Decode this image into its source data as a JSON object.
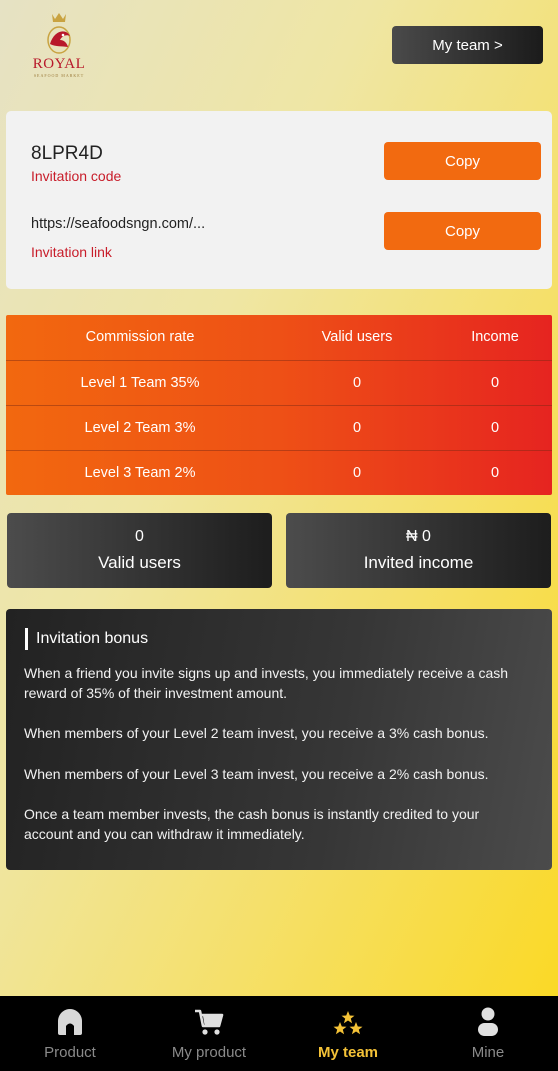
{
  "brand": {
    "name": "ROYAL",
    "tagline": "SEAFOOD MARKET"
  },
  "header": {
    "my_team_button": "My team >"
  },
  "invitation": {
    "code": "8LPR4D",
    "code_label": "Invitation code",
    "link": "https://seafoodsngn.com/...",
    "link_label": "Invitation link",
    "copy_label": "Copy"
  },
  "commission_table": {
    "headers": [
      "Commission rate",
      "Valid users",
      "Income"
    ],
    "rows": [
      [
        "Level 1 Team 35%",
        "0",
        "0"
      ],
      [
        "Level 2 Team 3%",
        "0",
        "0"
      ],
      [
        "Level 3 Team 2%",
        "0",
        "0"
      ]
    ]
  },
  "stats": {
    "valid_users": {
      "value": "0",
      "label": "Valid users"
    },
    "invited_income": {
      "value": "₦ 0",
      "label": "Invited income"
    }
  },
  "bonus": {
    "title": "Invitation bonus",
    "paragraphs": [
      "When a friend you invite signs up and invests, you immediately receive a cash reward of 35% of their investment amount.",
      "When members of your Level 2 team invest, you receive a 3% cash bonus.",
      "When members of your Level 3 team invest, you receive a 2% cash bonus.",
      "Once a team member invests, the cash bonus is instantly credited to your account and you can withdraw it immediately."
    ]
  },
  "tabbar": {
    "tabs": [
      {
        "label": "Product",
        "icon": "home-icon",
        "active": false
      },
      {
        "label": "My product",
        "icon": "cart-icon",
        "active": false
      },
      {
        "label": "My team",
        "icon": "stars-icon",
        "active": true
      },
      {
        "label": "Mine",
        "icon": "user-icon",
        "active": false
      }
    ]
  },
  "colors": {
    "accent_orange": "#f26a10",
    "label_red": "#c81d2a",
    "active_tab": "#f4c237"
  }
}
